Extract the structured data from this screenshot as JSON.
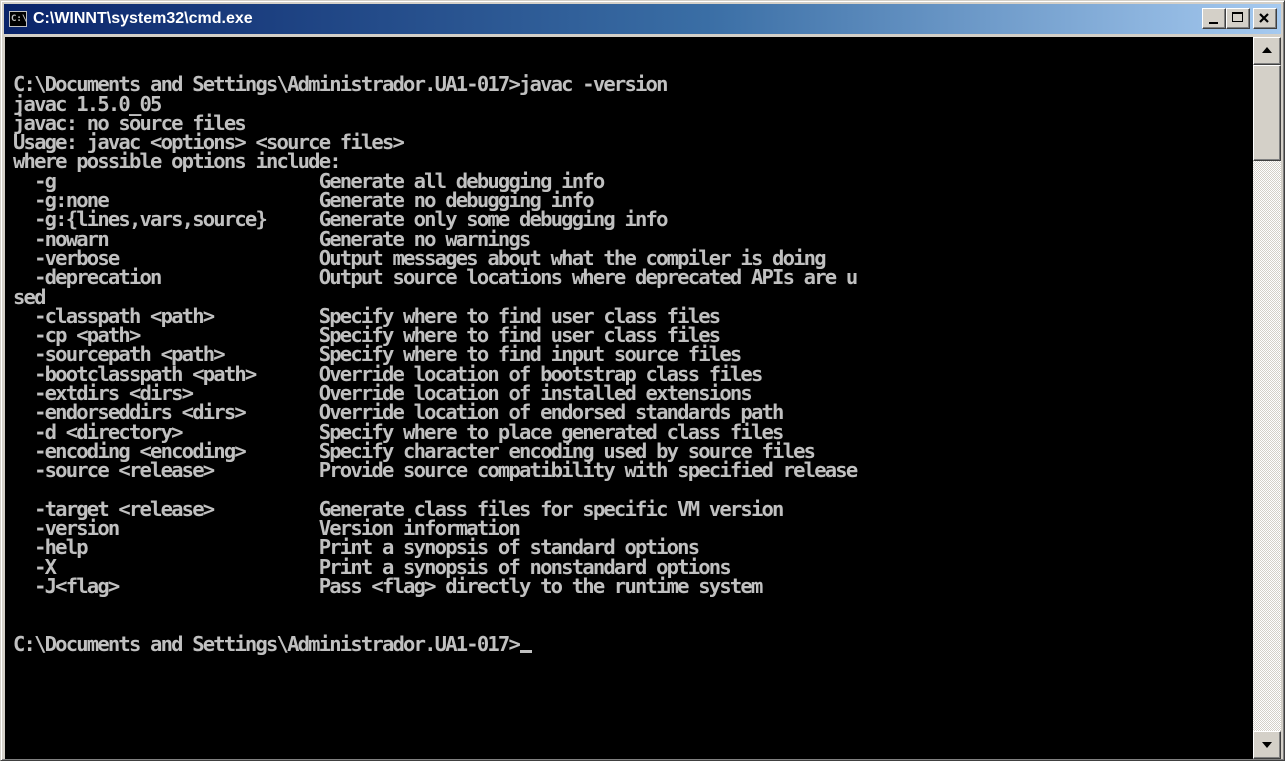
{
  "window": {
    "title": "C:\\WINNT\\system32\\cmd.exe",
    "icon_label": "C:\\"
  },
  "console": {
    "lines": [
      "",
      "C:\\Documents and Settings\\Administrador.UA1-017>javac -version",
      "javac 1.5.0_05",
      "javac: no source files",
      "Usage: javac <options> <source files>",
      "where possible options include:",
      "  -g                         Generate all debugging info",
      "  -g:none                    Generate no debugging info",
      "  -g:{lines,vars,source}     Generate only some debugging info",
      "  -nowarn                    Generate no warnings",
      "  -verbose                   Output messages about what the compiler is doing",
      "  -deprecation               Output source locations where deprecated APIs are u",
      "sed",
      "  -classpath <path>          Specify where to find user class files",
      "  -cp <path>                 Specify where to find user class files",
      "  -sourcepath <path>         Specify where to find input source files",
      "  -bootclasspath <path>      Override location of bootstrap class files",
      "  -extdirs <dirs>            Override location of installed extensions",
      "  -endorseddirs <dirs>       Override location of endorsed standards path",
      "  -d <directory>             Specify where to place generated class files",
      "  -encoding <encoding>       Specify character encoding used by source files",
      "  -source <release>          Provide source compatibility with specified release",
      "",
      "  -target <release>          Generate class files for specific VM version",
      "  -version                   Version information",
      "  -help                      Print a synopsis of standard options",
      "  -X                         Print a synopsis of nonstandard options",
      "  -J<flag>                   Pass <flag> directly to the runtime system",
      "",
      "",
      "C:\\Documents and Settings\\Administrador.UA1-017>"
    ]
  },
  "colors": {
    "console_bg": "#000000",
    "console_fg": "#c0c0c0",
    "titlebar_start": "#0a246a",
    "titlebar_end": "#a6caf0"
  },
  "icons": {
    "app": "console-icon",
    "minimize": "minimize-icon",
    "maximize": "maximize-icon",
    "close": "close-icon",
    "scroll_up": "scroll-up-icon",
    "scroll_down": "scroll-down-icon"
  }
}
